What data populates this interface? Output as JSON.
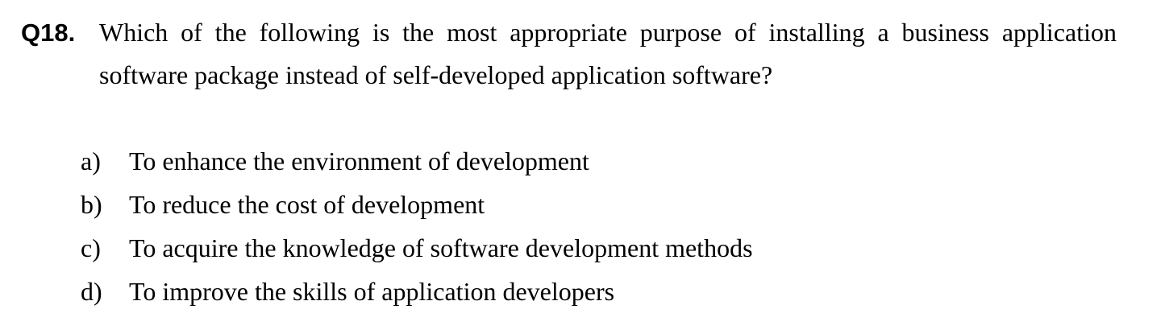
{
  "question": {
    "number": "Q18.",
    "text": "Which of the following is the most appropriate purpose of installing a business application software package instead of self-developed application software?"
  },
  "options": [
    {
      "label": "a)",
      "text": "To enhance the environment of development"
    },
    {
      "label": "b)",
      "text": "To reduce the cost of development"
    },
    {
      "label": "c)",
      "text": "To acquire the knowledge of software development methods"
    },
    {
      "label": "d)",
      "text": "To improve the skills of application developers"
    }
  ]
}
